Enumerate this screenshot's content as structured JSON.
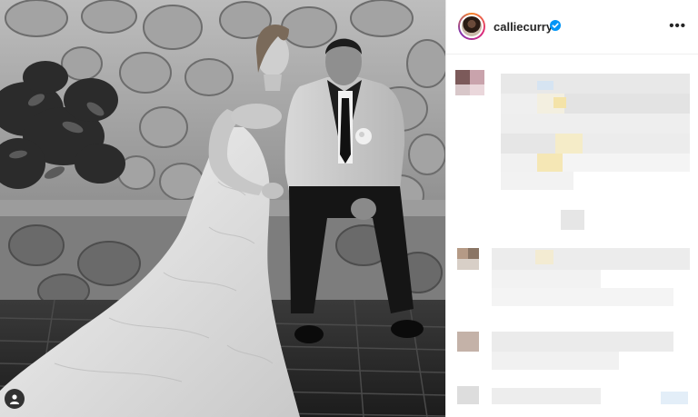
{
  "post": {
    "username": "calliecurry",
    "verified": true,
    "more_label": "•••"
  },
  "icons": {
    "verified": "verified-badge-icon",
    "more": "more-options-icon",
    "tag": "user-tag-icon"
  },
  "colors": {
    "verified_blue": "#0095f6",
    "text": "#262626"
  }
}
